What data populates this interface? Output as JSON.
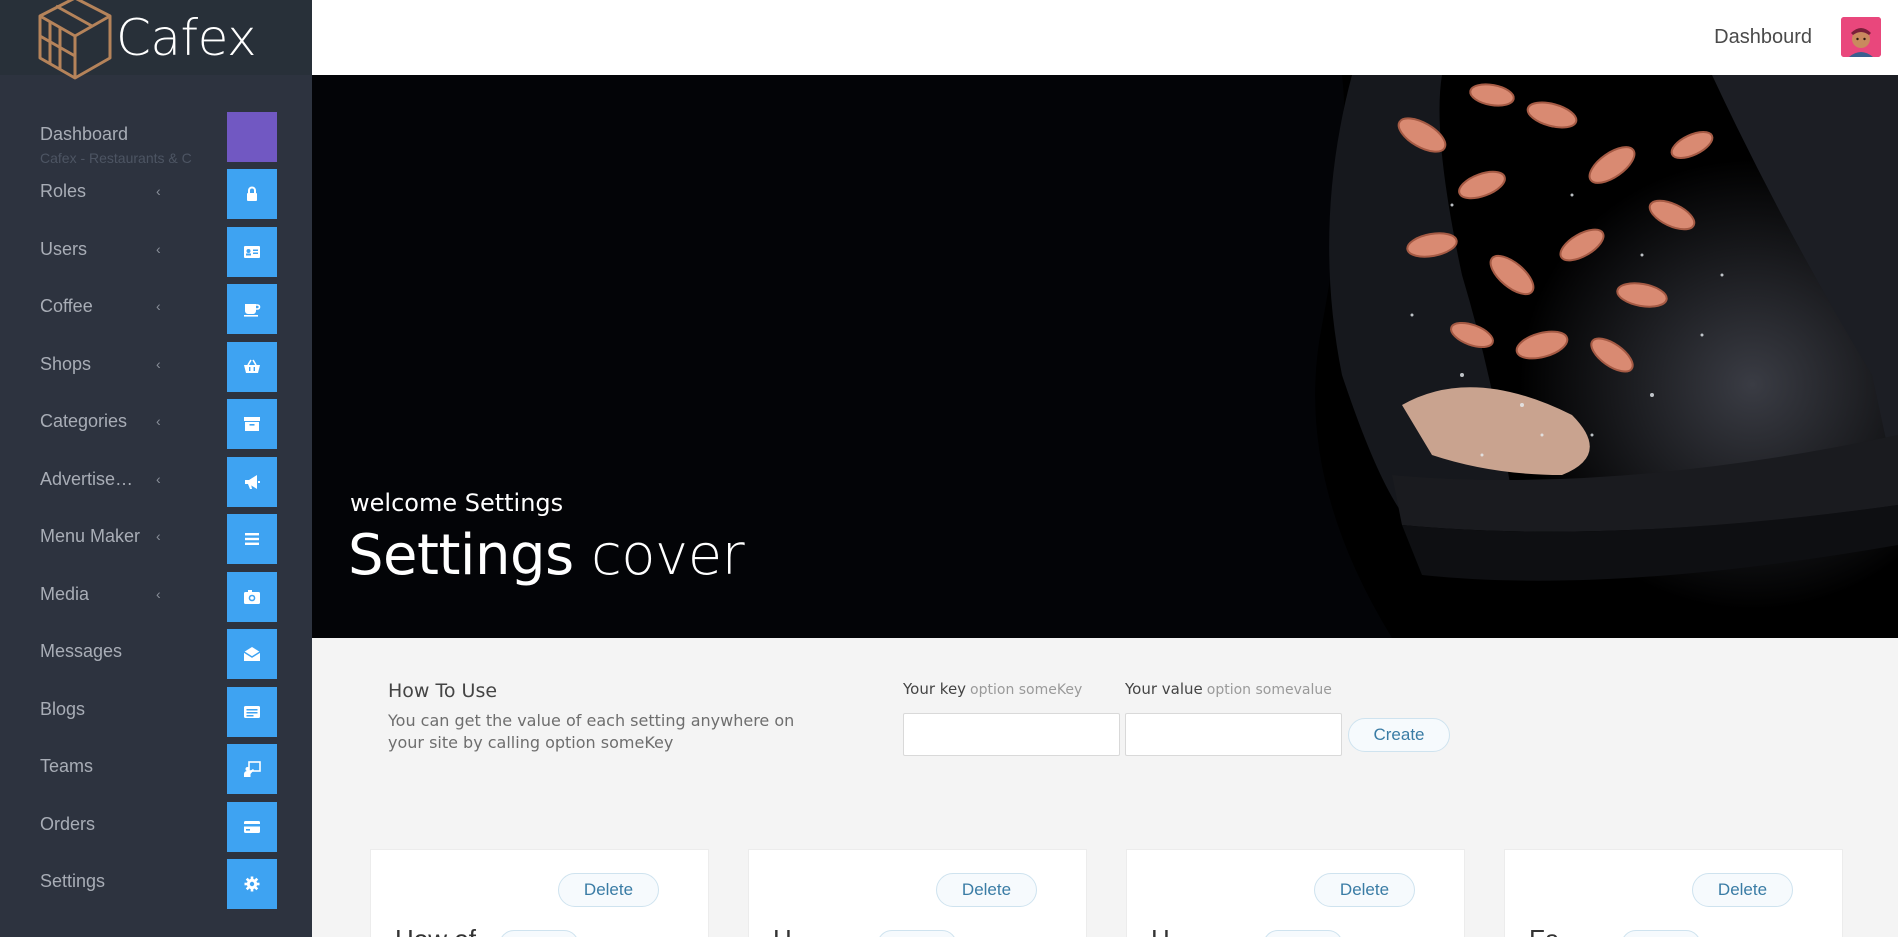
{
  "brand": {
    "name": "Cafex"
  },
  "sidebar": {
    "items": [
      {
        "label": "Dashboard",
        "sublabel": "Cafex - Restaurants & C",
        "icon": "dashboard-icon",
        "has_chevron": false
      },
      {
        "label": "Roles",
        "icon": "lock-icon",
        "has_chevron": true
      },
      {
        "label": "Users",
        "icon": "id-card-icon",
        "has_chevron": true
      },
      {
        "label": "Coffee",
        "icon": "coffee-cup-icon",
        "has_chevron": true
      },
      {
        "label": "Shops",
        "icon": "basket-icon",
        "has_chevron": true
      },
      {
        "label": "Categories",
        "icon": "archive-icon",
        "has_chevron": true
      },
      {
        "label": "Advertise…",
        "icon": "megaphone-icon",
        "has_chevron": true
      },
      {
        "label": "Menu Maker",
        "icon": "list-icon",
        "has_chevron": true
      },
      {
        "label": "Media",
        "icon": "camera-icon",
        "has_chevron": true
      },
      {
        "label": "Messages",
        "icon": "envelope-open-icon",
        "has_chevron": false
      },
      {
        "label": "Blogs",
        "icon": "newspaper-icon",
        "has_chevron": false
      },
      {
        "label": "Teams",
        "icon": "presentation-icon",
        "has_chevron": false
      },
      {
        "label": "Orders",
        "icon": "credit-card-icon",
        "has_chevron": false
      },
      {
        "label": "Settings",
        "icon": "gear-icon",
        "has_chevron": false
      }
    ],
    "chevron": "‹"
  },
  "topbar": {
    "title": "Dashbourd",
    "avatar": "user-avatar-icon"
  },
  "hero": {
    "subtitle": "welcome Settings",
    "title_bold": "Settings",
    "title_rest": "cover"
  },
  "howto": {
    "heading": "How To Use",
    "text": "You can get the value of each setting anywhere on your site by calling option someKey"
  },
  "form": {
    "key_label": "Your key",
    "key_hint": "option someKey",
    "key_value": "",
    "value_label": "Your value",
    "value_hint": "option somevalue",
    "value_value": "",
    "create_label": "Create"
  },
  "cards": [
    {
      "delete_label": "Delete",
      "name": "How of"
    },
    {
      "delete_label": "Delete",
      "name": "H"
    },
    {
      "delete_label": "Delete",
      "name": "H"
    },
    {
      "delete_label": "Delete",
      "name": "Fa"
    }
  ],
  "colors": {
    "sidebar_bg": "#2d333f",
    "tile_blue": "#3ea3f2",
    "tile_purple": "#7158c2",
    "avatar_bg": "#e9477c"
  }
}
